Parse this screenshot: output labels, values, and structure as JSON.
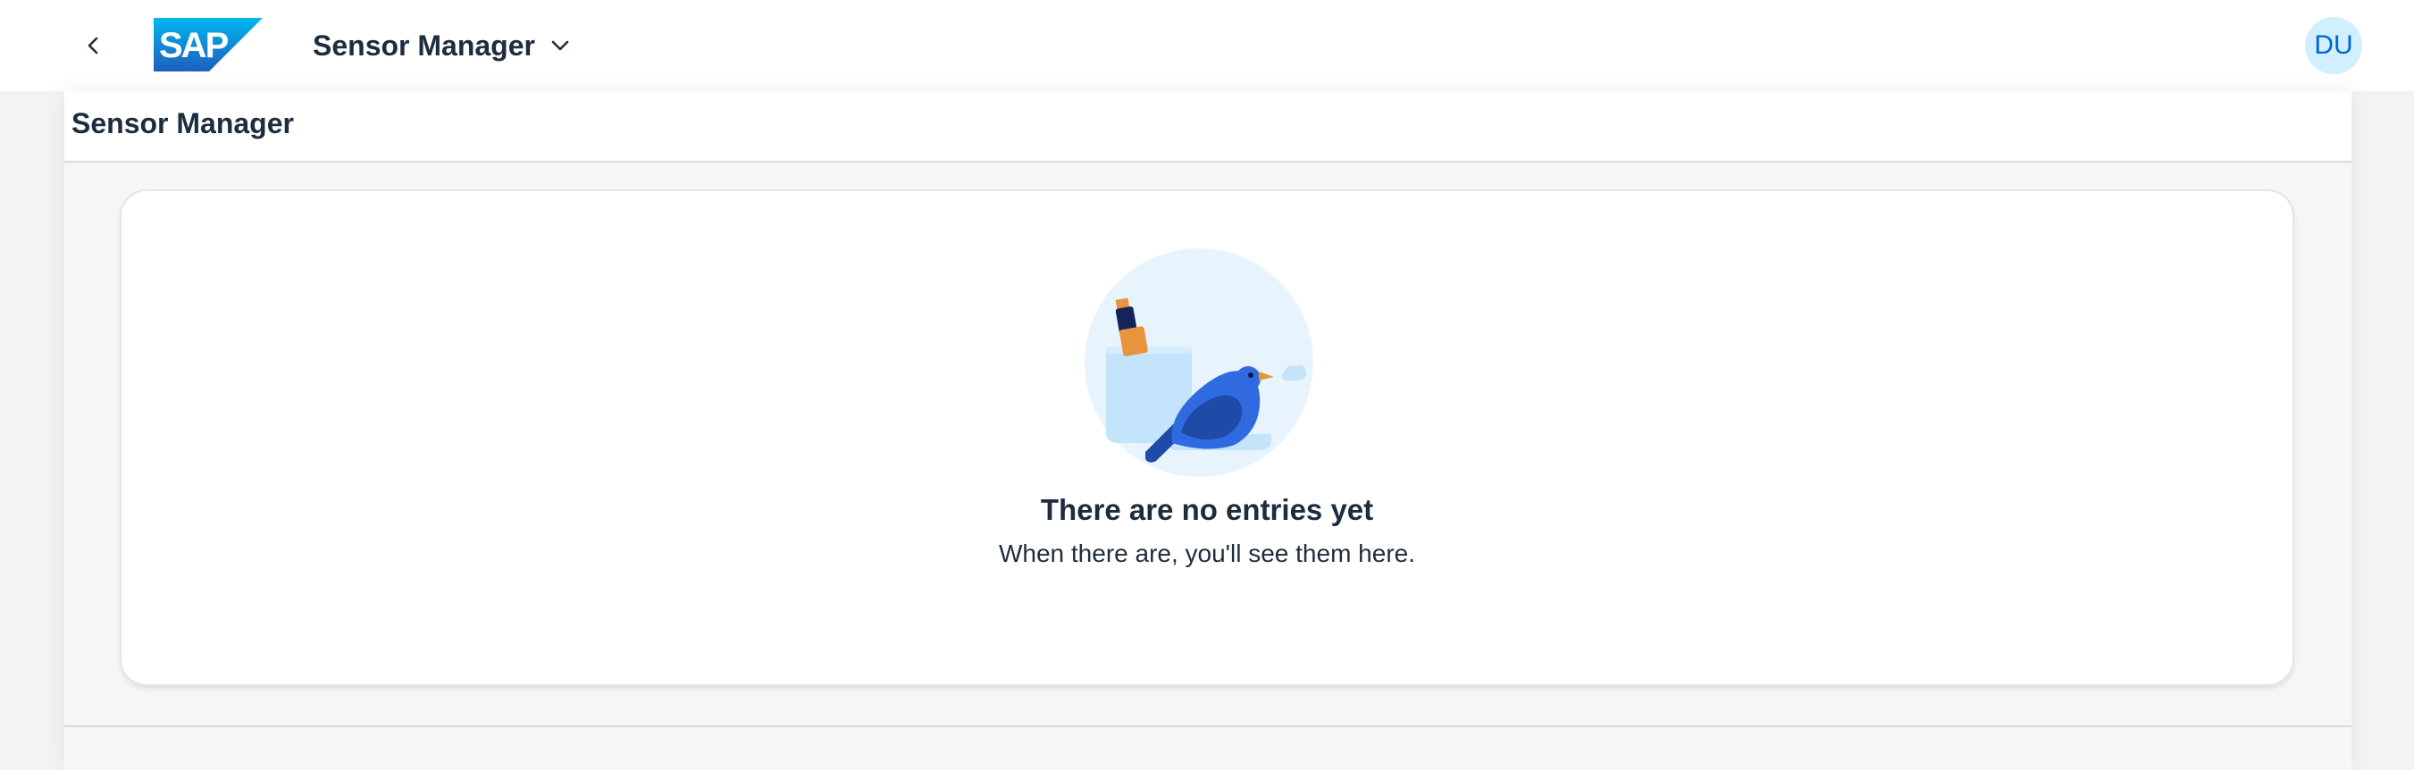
{
  "shellbar": {
    "back_icon": "chevron-left-icon",
    "logo_text": "SAP",
    "app_title": "Sensor Manager",
    "app_menu_icon": "chevron-down-icon",
    "avatar_initials": "DU"
  },
  "page": {
    "title": "Sensor Manager"
  },
  "empty_state": {
    "illustration": "bird-with-notebook-illustration",
    "title": "There are no entries yet",
    "subtitle": "When there are, you'll see them here."
  },
  "colors": {
    "brand_blue": "#0070f2",
    "avatar_bg": "#d1efff",
    "avatar_text": "#0064d9",
    "text": "#1d2d3e",
    "page_bg": "#f5f6f7"
  }
}
